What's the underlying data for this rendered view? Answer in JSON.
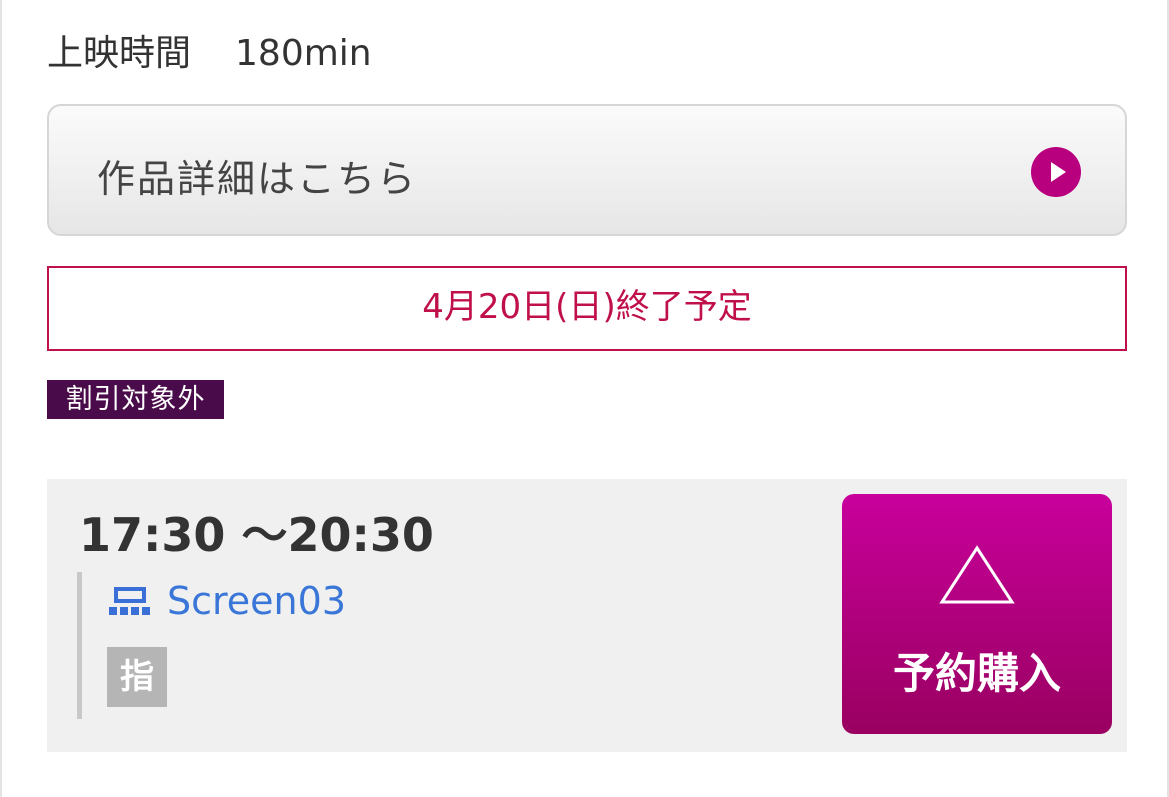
{
  "runtime": {
    "label": "上映時間",
    "value": "180min"
  },
  "details_button": {
    "label": "作品詳細はこちら",
    "icon": "play-circle-icon"
  },
  "end_notice": "4月20日(日)終了予定",
  "discount_badge": "割引対象外",
  "showtime": {
    "time": "17:30 〜20:30",
    "screen": {
      "icon": "screen-icon",
      "name": "Screen03"
    },
    "seat_badge": "指",
    "purchase_button": {
      "availability_icon": "triangle-icon",
      "label": "予約購入"
    }
  },
  "colors": {
    "accent": "#b8007f",
    "notice_red": "#c0104a",
    "badge_dark": "#4a0b4a",
    "link_blue": "#3a76d8",
    "panel_bg": "#f0f0f0"
  }
}
